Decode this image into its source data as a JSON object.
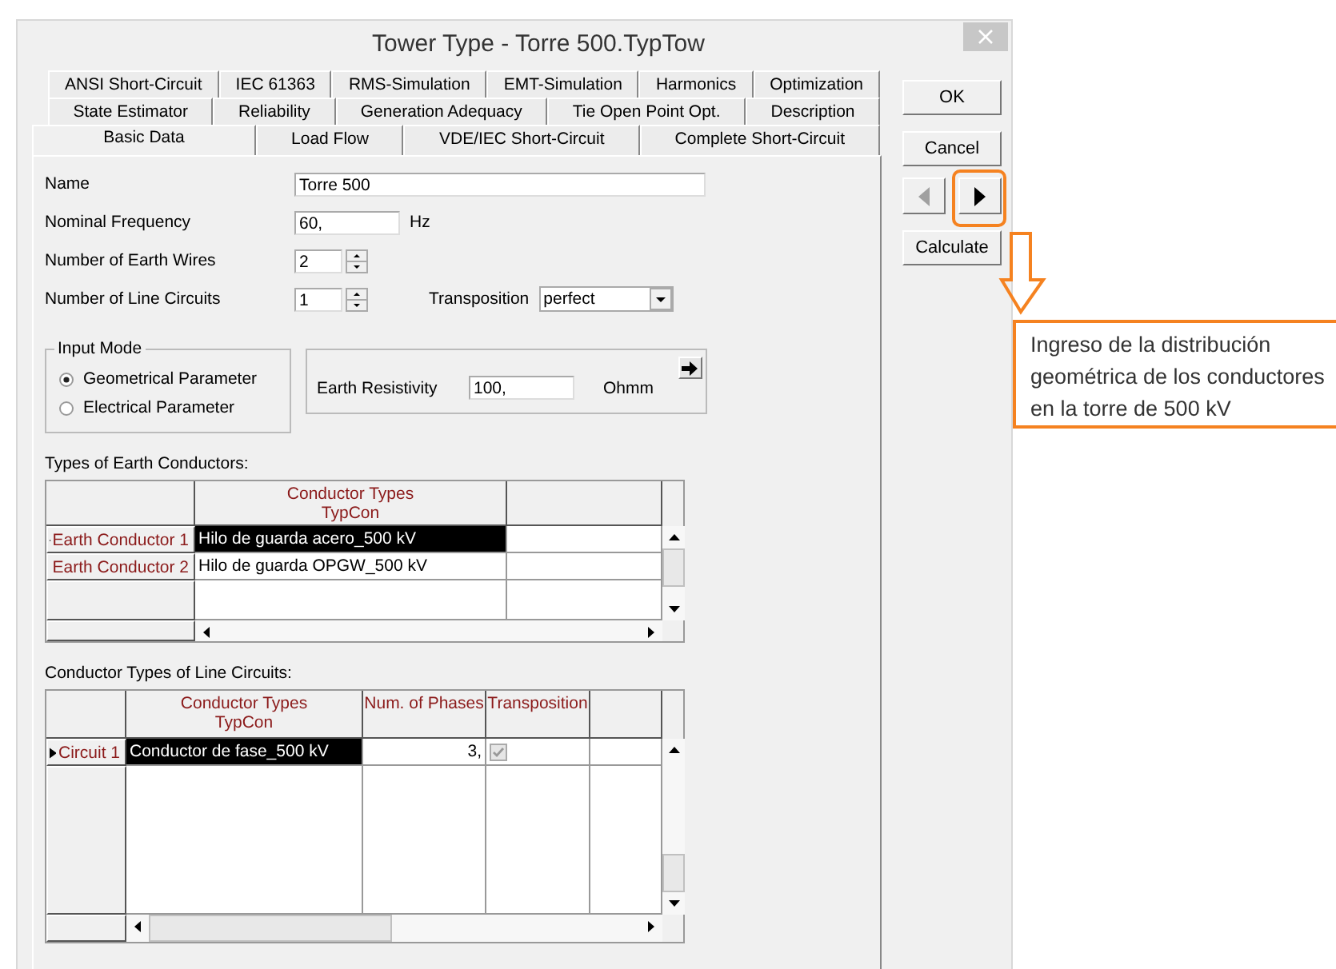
{
  "window": {
    "title": "Tower Type - Torre 500.TypTow"
  },
  "tab_rows": [
    [
      {
        "label": "ANSI Short-Circuit",
        "selected": false
      },
      {
        "label": "IEC 61363",
        "selected": false
      },
      {
        "label": "RMS-Simulation",
        "selected": false
      },
      {
        "label": "EMT-Simulation",
        "selected": false
      },
      {
        "label": "Harmonics",
        "selected": false
      },
      {
        "label": "Optimization",
        "selected": false
      }
    ],
    [
      {
        "label": "State Estimator",
        "selected": false
      },
      {
        "label": "Reliability",
        "selected": false
      },
      {
        "label": "Generation Adequacy",
        "selected": false
      },
      {
        "label": "Tie Open Point Opt.",
        "selected": false
      },
      {
        "label": "Description",
        "selected": false
      }
    ],
    [
      {
        "label": "Basic Data",
        "selected": true
      },
      {
        "label": "Load Flow",
        "selected": false
      },
      {
        "label": "VDE/IEC Short-Circuit",
        "selected": false
      },
      {
        "label": "Complete Short-Circuit",
        "selected": false
      }
    ]
  ],
  "fields": [
    {
      "kind": "text",
      "label": "Name",
      "value": "Torre 500"
    },
    {
      "kind": "unit",
      "label": "Nominal Frequency",
      "value": "60,",
      "unit": "Hz"
    },
    {
      "kind": "spin",
      "label": "Number of Earth Wires",
      "value": "2"
    },
    {
      "kind": "spin",
      "label": "Number of Line Circuits",
      "value": "1",
      "extra_label": "Transposition",
      "extra_value": "perfect"
    }
  ],
  "input_mode": {
    "legend": "Input Mode",
    "options": [
      {
        "label": "Geometrical Parameter",
        "selected": true
      },
      {
        "label": "Electrical Parameter",
        "selected": false
      }
    ]
  },
  "earth_resistivity": {
    "label": "Earth Resistivity",
    "value": "100,",
    "unit": "Ohmm"
  },
  "earth_conductors": {
    "caption": "Types of Earth Conductors:",
    "columns": [
      "Conductor Types\nTypCon"
    ],
    "rows": [
      {
        "header": "Earth Conductor 1",
        "value": "Hilo de guarda acero_500 kV",
        "selected": true
      },
      {
        "header": "Earth Conductor 2",
        "value": "Hilo de guarda OPGW_500 kV",
        "selected": false
      }
    ]
  },
  "line_circuits": {
    "caption": "Conductor Types of Line Circuits:",
    "columns": [
      "Conductor Types\nTypCon",
      "Num. of Phases",
      "Transposition"
    ],
    "rows": [
      {
        "header": "Circuit 1",
        "conductor": "Conductor de fase_500 kV",
        "phases": "3,",
        "transposition": true,
        "selected": true
      }
    ]
  },
  "buttons": [
    {
      "kind": "text",
      "label": "OK"
    },
    {
      "kind": "text",
      "label": "Cancel"
    },
    {
      "kind": "nav",
      "prev_disabled": true,
      "next_disabled": false
    },
    {
      "kind": "text",
      "label": "Calculate"
    }
  ],
  "annotation": {
    "text": "Ingreso de la distribución geométrica de los conductores en la torre de 500 kV"
  }
}
